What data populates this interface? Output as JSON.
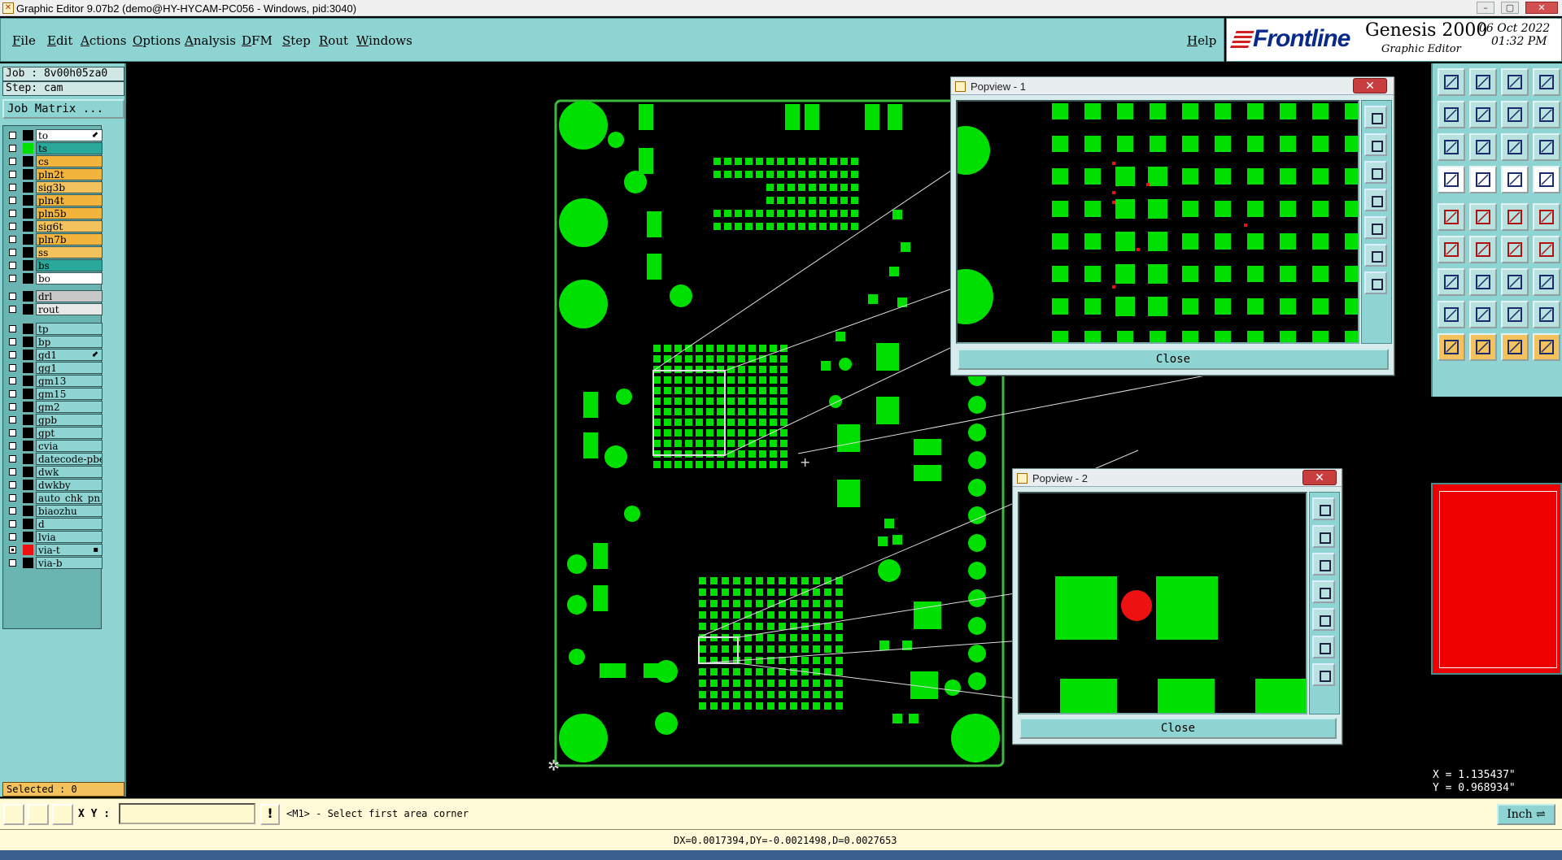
{
  "window": {
    "title": "Graphic Editor 9.07b2 (demo@HY-HYCAM-PC056 - Windows, pid:3040)",
    "controls": [
      "–",
      "▢",
      "✕"
    ]
  },
  "menu": {
    "items": [
      "File",
      "Edit",
      "Actions",
      "Options",
      "Analysis",
      "DFM",
      "Step",
      "Rout",
      "Windows"
    ],
    "help": "Help"
  },
  "brand": {
    "logo": "Frontline",
    "product": "Genesis 2000",
    "subtitle": "Graphic Editor",
    "date": "06 Oct 2022",
    "time": "01:32 PM"
  },
  "job": {
    "job_label": "Job : 8v00h05za0",
    "step_label": "Step: cam",
    "job_matrix_button": "Job Matrix ..."
  },
  "layers": [
    {
      "name": "to",
      "color": "#ffffff",
      "swatch": "#000000",
      "mark": "⬋",
      "checked": false
    },
    {
      "name": "ts",
      "color": "#2aa89a",
      "swatch": "#00e000",
      "mark": "",
      "checked": false
    },
    {
      "name": "cs",
      "color": "#f3b43c",
      "swatch": "#000000",
      "mark": "",
      "checked": false
    },
    {
      "name": "pln2t",
      "color": "#f3b43c",
      "swatch": "#000000",
      "mark": "",
      "checked": false
    },
    {
      "name": "sig3b",
      "color": "#f3c25c",
      "swatch": "#000000",
      "mark": "",
      "checked": false
    },
    {
      "name": "pln4t",
      "color": "#f3b43c",
      "swatch": "#000000",
      "mark": "",
      "checked": false
    },
    {
      "name": "pln5b",
      "color": "#f3b43c",
      "swatch": "#000000",
      "mark": "",
      "checked": false
    },
    {
      "name": "sig6t",
      "color": "#f3c25c",
      "swatch": "#000000",
      "mark": "",
      "checked": false
    },
    {
      "name": "pln7b",
      "color": "#f3b43c",
      "swatch": "#000000",
      "mark": "",
      "checked": false
    },
    {
      "name": "ss",
      "color": "#f3c25c",
      "swatch": "#000000",
      "mark": "",
      "checked": false
    },
    {
      "name": "bs",
      "color": "#2aa89a",
      "swatch": "#000000",
      "mark": "",
      "checked": false
    },
    {
      "name": "bo",
      "color": "#ffffff",
      "swatch": "#000000",
      "mark": "",
      "checked": false
    },
    {
      "name": "drl",
      "color": "#c8c8c8",
      "swatch": "#000000",
      "mark": "",
      "checked": false
    },
    {
      "name": "rout",
      "color": "#e8e8e8",
      "swatch": "#000000",
      "mark": "",
      "checked": false
    },
    {
      "name": "tp",
      "color": "#8ed4d2",
      "swatch": "#000000",
      "mark": "",
      "checked": false
    },
    {
      "name": "bp",
      "color": "#8ed4d2",
      "swatch": "#000000",
      "mark": "",
      "checked": false
    },
    {
      "name": "gd1",
      "color": "#8ed4d2",
      "swatch": "#000000",
      "mark": "⬋",
      "checked": false
    },
    {
      "name": "gg1",
      "color": "#8ed4d2",
      "swatch": "#000000",
      "mark": "",
      "checked": false
    },
    {
      "name": "gm13",
      "color": "#8ed4d2",
      "swatch": "#000000",
      "mark": "",
      "checked": false
    },
    {
      "name": "gm15",
      "color": "#8ed4d2",
      "swatch": "#000000",
      "mark": "",
      "checked": false
    },
    {
      "name": "gm2",
      "color": "#8ed4d2",
      "swatch": "#000000",
      "mark": "",
      "checked": false
    },
    {
      "name": "gpb",
      "color": "#8ed4d2",
      "swatch": "#000000",
      "mark": "",
      "checked": false
    },
    {
      "name": "gpt",
      "color": "#8ed4d2",
      "swatch": "#000000",
      "mark": "",
      "checked": false
    },
    {
      "name": "cvia",
      "color": "#8ed4d2",
      "swatch": "#000000",
      "mark": "",
      "checked": false
    },
    {
      "name": "datecode-pbe",
      "color": "#8ed4d2",
      "swatch": "#000000",
      "mark": "",
      "checked": false
    },
    {
      "name": "dwk",
      "color": "#8ed4d2",
      "swatch": "#000000",
      "mark": "",
      "checked": false
    },
    {
      "name": "dwkby",
      "color": "#8ed4d2",
      "swatch": "#000000",
      "mark": "",
      "checked": false
    },
    {
      "name": "auto_chk_pn",
      "color": "#8ed4d2",
      "swatch": "#000000",
      "mark": "",
      "checked": false
    },
    {
      "name": "biaozhu",
      "color": "#8ed4d2",
      "swatch": "#000000",
      "mark": "",
      "checked": false
    },
    {
      "name": "d",
      "color": "#8ed4d2",
      "swatch": "#000000",
      "mark": "",
      "checked": false
    },
    {
      "name": "lvia",
      "color": "#8ed4d2",
      "swatch": "#000000",
      "mark": "",
      "checked": false
    },
    {
      "name": "via-t",
      "color": "#8ed4d2",
      "swatch": "#ee1111",
      "mark": "▪",
      "checked": true
    },
    {
      "name": "via-b",
      "color": "#8ed4d2",
      "swatch": "#000000",
      "mark": "",
      "checked": false
    }
  ],
  "selected": "Selected : 0",
  "popview1": {
    "title": "Popview - 1",
    "close_label": "Close"
  },
  "popview2": {
    "title": "Popview - 2",
    "close_label": "Close"
  },
  "coords": {
    "x": "X = 1.135437\"",
    "y": "Y = 0.968934\""
  },
  "command": {
    "xy_label": "X Y :",
    "xy_value": "",
    "prompt": "<M1> - Select first area corner",
    "unit": "Inch"
  },
  "status": "DX=0.0017394,DY=-0.0021498,D=0.0027653",
  "colors": {
    "panel": "#8ed4d2",
    "copper": "#00e000",
    "highlight": "#ee0000",
    "command_bg": "#fffbd8"
  }
}
